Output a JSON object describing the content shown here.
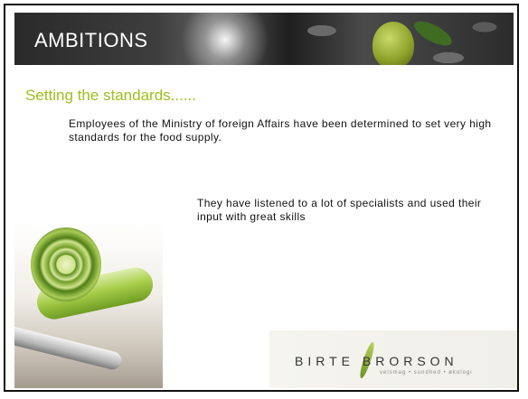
{
  "slide": {
    "banner_title": "AMBITIONS",
    "subtitle": "Setting the standards......",
    "paragraph_1": "Employees of the Ministry of foreign Affairs have been determined to set very high standards for the food supply.",
    "paragraph_2": "They have listened to a lot of specialists and used their input with great skills"
  },
  "logo": {
    "name": "BIRTE BRORSON",
    "tagline": "velsmag • sundhed • økologi"
  },
  "colors": {
    "subtitle_green": "#9cbf1c",
    "banner_dark": "#2a2a2a"
  }
}
